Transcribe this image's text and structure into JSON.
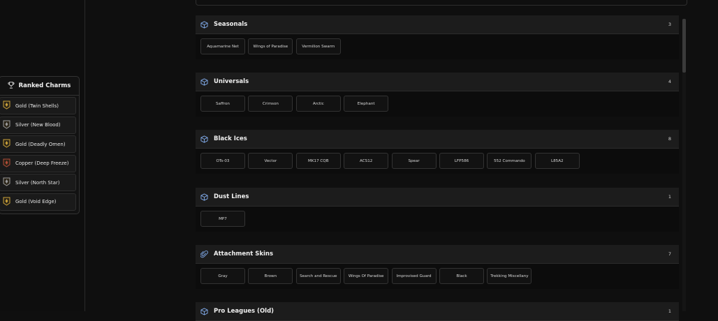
{
  "ranked_charms": {
    "title": "Ranked Charms",
    "items": [
      {
        "label": "Gold (Twin Shells)",
        "tier": "gold"
      },
      {
        "label": "Silver (New Blood)",
        "tier": "silver"
      },
      {
        "label": "Gold (Deadly Omen)",
        "tier": "gold"
      },
      {
        "label": "Copper (Deep Freeze)",
        "tier": "copper"
      },
      {
        "label": "Silver (North Star)",
        "tier": "silver"
      },
      {
        "label": "Gold (Void Edge)",
        "tier": "gold"
      }
    ]
  },
  "sections": [
    {
      "title": "Seasonals",
      "count": "3",
      "icon": "cube-icon",
      "items": [
        "Aquamarine Net",
        "Wings of Paradise",
        "Vermilion Swarm"
      ]
    },
    {
      "title": "Universals",
      "count": "4",
      "icon": "cube-icon",
      "items": [
        "Saffron",
        "Crimson",
        "Arctic",
        "Elephant"
      ]
    },
    {
      "title": "Black Ices",
      "count": "8",
      "icon": "cube-icon",
      "items": [
        "OTs-03",
        "Vector",
        "MK17 CQB",
        "ACS12",
        "Spear",
        "LFP586",
        "552 Commando",
        "L85A2"
      ]
    },
    {
      "title": "Dust Lines",
      "count": "1",
      "icon": "cube-icon",
      "items": [
        "MP7"
      ]
    },
    {
      "title": "Attachment Skins",
      "count": "7",
      "icon": "paperclip-icon",
      "items": [
        "Gray",
        "Brown",
        "Search and Rescue",
        "Wings Of Paradise",
        "Improvised Guard",
        "Black",
        "Trekking Miscellany"
      ]
    },
    {
      "title": "Pro Leagues (Old)",
      "count": "1",
      "icon": "cube-icon",
      "items": []
    }
  ],
  "colors": {
    "gold": "#c9a13a",
    "silver": "#9a9a9a",
    "copper": "#b04a38",
    "accent": "#7fa8e6"
  }
}
